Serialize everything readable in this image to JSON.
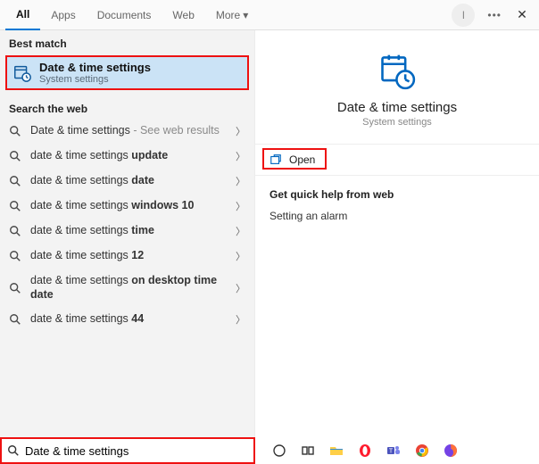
{
  "tabs": {
    "all": "All",
    "apps": "Apps",
    "documents": "Documents",
    "web": "Web",
    "more": "More"
  },
  "header": {
    "avatar": "I"
  },
  "left": {
    "best_label": "Best match",
    "best_title": "Date & time settings",
    "best_sub": "System settings",
    "web_label": "Search the web",
    "items": [
      {
        "pre": "Date & time settings",
        "bold": "",
        "hint": " - See web results"
      },
      {
        "pre": "date & time settings ",
        "bold": "update",
        "hint": ""
      },
      {
        "pre": "date & time settings ",
        "bold": "date",
        "hint": ""
      },
      {
        "pre": "date & time settings ",
        "bold": "windows 10",
        "hint": ""
      },
      {
        "pre": "date & time settings ",
        "bold": "time",
        "hint": ""
      },
      {
        "pre": "date & time settings ",
        "bold": "12",
        "hint": ""
      },
      {
        "pre": "date & time settings ",
        "bold": "on desktop time date",
        "hint": ""
      },
      {
        "pre": "date & time settings ",
        "bold": "44",
        "hint": ""
      }
    ]
  },
  "right": {
    "title": "Date & time settings",
    "sub": "System settings",
    "open": "Open",
    "help_h": "Get quick help from web",
    "help_link": "Setting an alarm"
  },
  "search": {
    "value": "Date & time settings"
  }
}
